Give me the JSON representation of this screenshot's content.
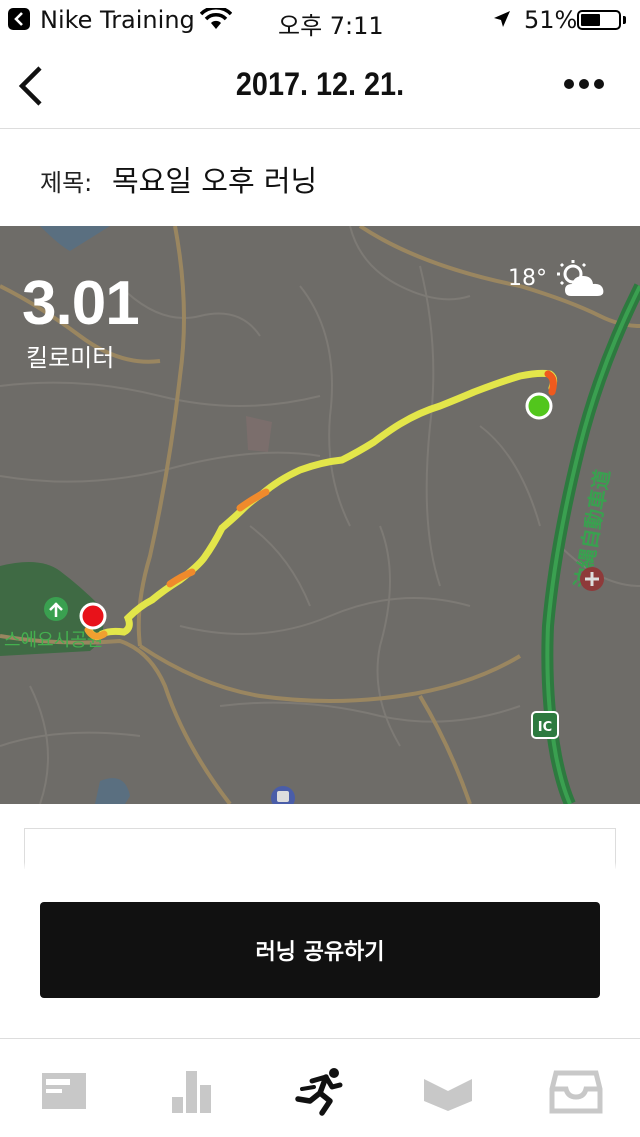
{
  "status_bar": {
    "app_name": "Nike Training",
    "time": "오후 7:11",
    "battery": "51%"
  },
  "nav": {
    "title": "2017. 12. 21."
  },
  "run_title": {
    "label": "제목:",
    "value": "목요일 오후 러닝"
  },
  "map": {
    "distance": "3.01",
    "distance_unit": "킬로미터",
    "temperature": "18°",
    "weather_icon": "partly-cloudy-icon",
    "park_label": "스에요시공원",
    "expressway_label": "沖縄自動車道",
    "interchange_label": "IC",
    "colors": {
      "route_slow": "#e3e64a",
      "route_fast": "#f08a2c",
      "start": "#52c61c",
      "finish": "#e8121a"
    }
  },
  "share_button": "러닝 공유하기",
  "tabs": [
    {
      "icon": "feed-icon"
    },
    {
      "icon": "activity-chart-icon"
    },
    {
      "icon": "run-icon",
      "active": true
    },
    {
      "icon": "club-icon"
    },
    {
      "icon": "inbox-icon"
    }
  ]
}
